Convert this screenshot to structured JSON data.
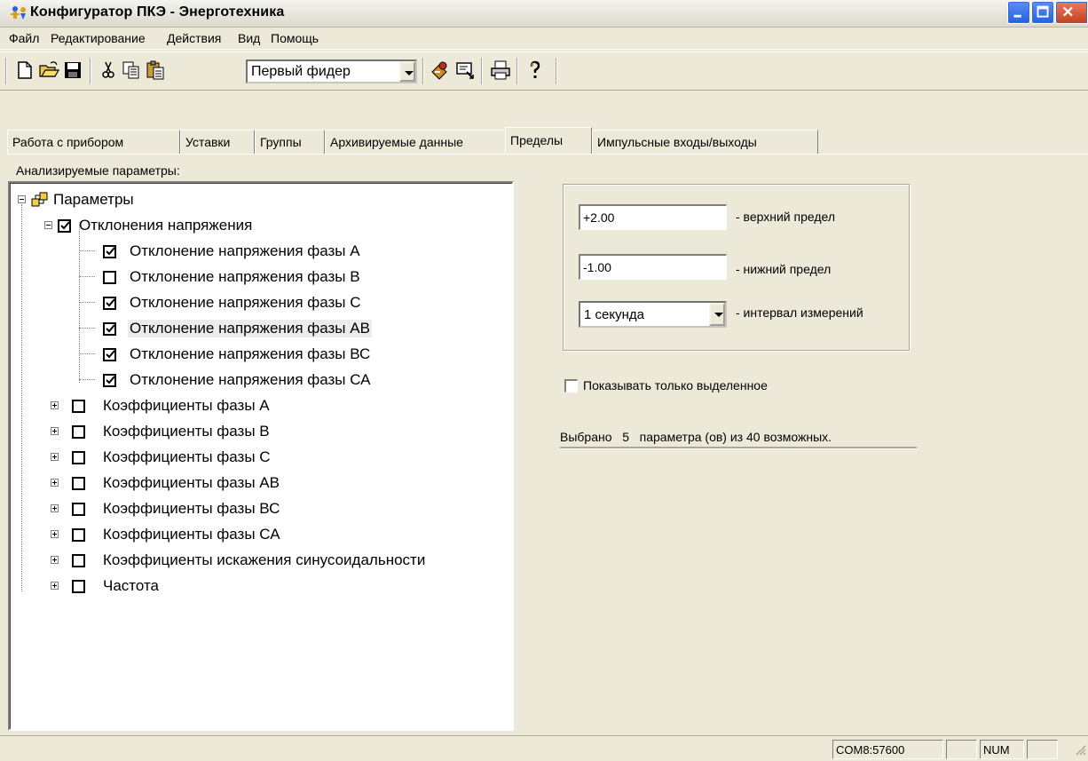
{
  "window": {
    "title": "Конфигуратор ПКЭ - Энерготехника"
  },
  "menu": [
    "Файл",
    "Редактирование",
    "Действия",
    "Вид",
    "Помощь"
  ],
  "toolbar": {
    "feeder_selected": "Первый фидер",
    "icons": [
      "new-file-icon",
      "open-folder-icon",
      "save-icon",
      "cut-icon",
      "copy-icon",
      "paste-icon",
      "device-read-icon",
      "device-write-icon",
      "print-icon",
      "help-icon"
    ]
  },
  "tabs": [
    {
      "label": "Работа с прибором",
      "active": false
    },
    {
      "label": "Уставки",
      "active": false
    },
    {
      "label": "Группы",
      "active": false
    },
    {
      "label": "Архивируемые данные",
      "active": false
    },
    {
      "label": "Пределы",
      "active": true
    },
    {
      "label": "Импульсные входы/выходы",
      "active": false
    }
  ],
  "analyzed_label": "Анализируемые параметры:",
  "tree": {
    "root": "Параметры",
    "groups": [
      {
        "label": "Отклонения напряжения",
        "checked": true,
        "expanded": true,
        "children": [
          {
            "label": "Отклонение напряжения фазы А",
            "checked": true,
            "selected": false
          },
          {
            "label": "Отклонение напряжения фазы В",
            "checked": false,
            "selected": false
          },
          {
            "label": "Отклонение напряжения фазы С",
            "checked": true,
            "selected": false
          },
          {
            "label": "Отклонение напряжения фазы АВ",
            "checked": true,
            "selected": true
          },
          {
            "label": "Отклонение напряжения фазы ВС",
            "checked": true,
            "selected": false
          },
          {
            "label": "Отклонение напряжения фазы СА",
            "checked": true,
            "selected": false
          }
        ]
      },
      {
        "label": "Коэффициенты фазы А",
        "checked": false,
        "expanded": false
      },
      {
        "label": "Коэффициенты фазы В",
        "checked": false,
        "expanded": false
      },
      {
        "label": "Коэффициенты фазы С",
        "checked": false,
        "expanded": false
      },
      {
        "label": "Коэффициенты фазы АВ",
        "checked": false,
        "expanded": false
      },
      {
        "label": "Коэффициенты фазы ВС",
        "checked": false,
        "expanded": false
      },
      {
        "label": "Коэффициенты фазы СА",
        "checked": false,
        "expanded": false
      },
      {
        "label": "Коэффициенты искажения синусоидальности",
        "checked": false,
        "expanded": false
      },
      {
        "label": "Частота",
        "checked": false,
        "expanded": false
      }
    ]
  },
  "limits": {
    "upper_value": "+2.00",
    "upper_label": "- верхний предел",
    "lower_value": "-1.00",
    "lower_label": "- нижний предел",
    "interval_value": "1 секунда",
    "interval_label": "- интервал измерений"
  },
  "show_only_selected": {
    "label": "Показывать только выделенное",
    "checked": false
  },
  "summary": {
    "prefix": "Выбрано",
    "count": "5",
    "suffix": "параметра (ов) из 40 возможных."
  },
  "statusbar": {
    "port": "COM8:57600",
    "pane2": "",
    "num": "NUM",
    "pane4": ""
  }
}
